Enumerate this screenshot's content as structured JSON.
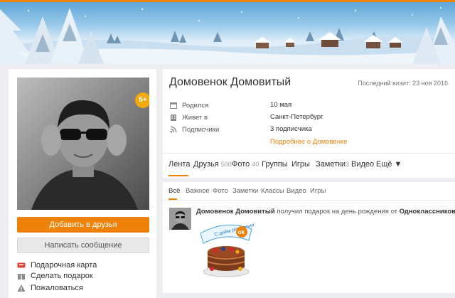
{
  "profile": {
    "name": "Домовенок Домовитый",
    "last_visit": "Последний визит: 23 ноя 2016",
    "badge": "5+",
    "info": [
      {
        "label": "Родился",
        "value": "10 мая",
        "icon": "calendar-icon"
      },
      {
        "label": "Живет в",
        "value": "Санкт-Петербург",
        "icon": "building-icon"
      },
      {
        "label": "Подписчики",
        "value": "3 подписчика",
        "icon": "rss-icon"
      }
    ],
    "more_link": "Подробнее о Домовенке"
  },
  "actions": {
    "add_friend": "Добавить в друзья",
    "write_message": "Написать сообщение",
    "items": [
      {
        "label": "Подарочная карта",
        "icon": "gift-card-icon"
      },
      {
        "label": "Сделать подарок",
        "icon": "gift-icon"
      },
      {
        "label": "Пожаловаться",
        "icon": "warning-icon"
      }
    ]
  },
  "tabs": [
    {
      "label": "Лента",
      "count": ""
    },
    {
      "label": "Друзья",
      "count": "500"
    },
    {
      "label": "Фото",
      "count": "40"
    },
    {
      "label": "Группы",
      "count": ""
    },
    {
      "label": "Игры",
      "count": ""
    },
    {
      "label": "Заметки",
      "count": "3"
    },
    {
      "label": "Видео",
      "count": ""
    },
    {
      "label": "Ещё ▼",
      "count": ""
    }
  ],
  "feed_tabs": [
    "Всё",
    "Важное",
    "Фото",
    "Заметки",
    "Классы",
    "Видео",
    "Игры"
  ],
  "post": {
    "author": "Домовенок Домовитый",
    "action": " получил подарок на день рождения от ",
    "target": "Одноклассников",
    "gift_text": "С днём рождения!",
    "gift_logo": "ok"
  },
  "colors": {
    "accent": "#ee8208",
    "badge": "#f2a90d",
    "banner_sky": "#9ccbeb"
  }
}
